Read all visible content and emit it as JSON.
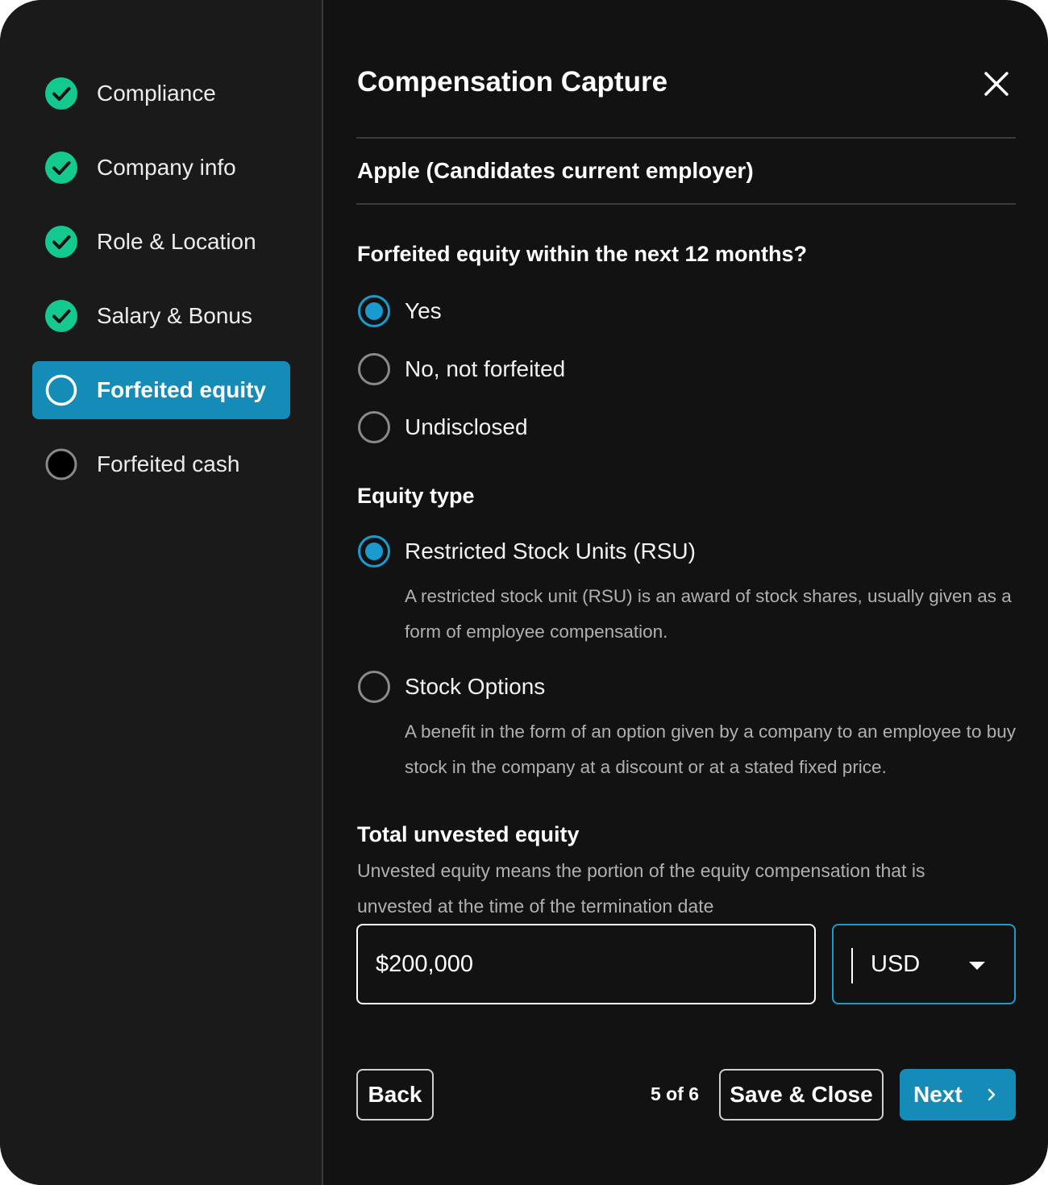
{
  "sidebar": {
    "steps": [
      {
        "label": "Compliance",
        "status": "complete"
      },
      {
        "label": "Company info",
        "status": "complete"
      },
      {
        "label": "Role & Location",
        "status": "complete"
      },
      {
        "label": "Salary & Bonus",
        "status": "complete"
      },
      {
        "label": "Forfeited equity",
        "status": "current"
      },
      {
        "label": "Forfeited cash",
        "status": "pending"
      }
    ]
  },
  "header": {
    "title": "Compensation Capture",
    "close_icon": "close-icon"
  },
  "employer": "Apple (Candidates current employer)",
  "forfeited": {
    "question": "Forfeited equity within the next 12 months?",
    "options": [
      {
        "label": "Yes",
        "selected": true
      },
      {
        "label": "No, not forfeited",
        "selected": false
      },
      {
        "label": "Undisclosed",
        "selected": false
      }
    ]
  },
  "equity_type": {
    "heading": "Equity type",
    "options": [
      {
        "label": "Restricted Stock Units (RSU)",
        "selected": true,
        "description": "A restricted stock unit (RSU) is an award of stock shares, usually given as a form of employee compensation."
      },
      {
        "label": "Stock Options",
        "selected": false,
        "description": "A benefit in the form of an option given by a company to an employee to buy stock in the company at a discount or at a stated fixed price."
      }
    ]
  },
  "unvested": {
    "heading": "Total unvested equity",
    "help": "Unvested equity means the portion of the equity compensation that is unvested at the time of the termination date",
    "amount": "$200,000",
    "currency": "USD"
  },
  "footer": {
    "back_label": "Back",
    "pager": "5 of 6",
    "save_label": "Save & Close",
    "next_label": "Next"
  },
  "colors": {
    "accent": "#158bb8",
    "success": "#14c98f",
    "background": "#121212",
    "sidebar": "#1a1a1a"
  }
}
